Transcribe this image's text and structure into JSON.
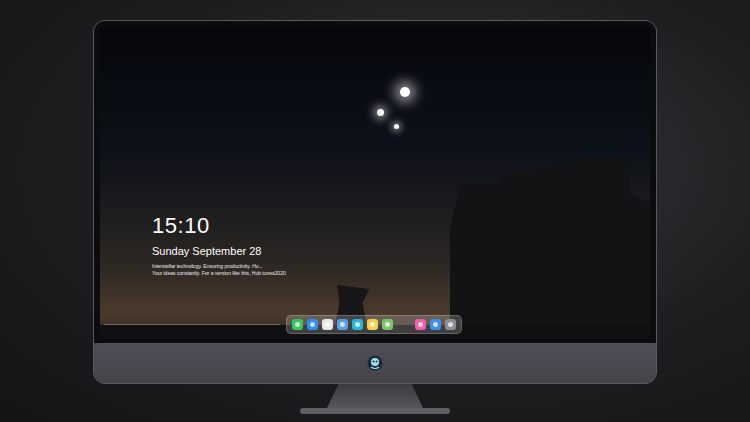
{
  "clock": {
    "time": "15:10",
    "date": "Sunday September 28",
    "notes": [
      "Interstellar technology. Ensuring productivity. Hu...",
      "Your ideas constantly. For a version like this, Hub tunes2020"
    ]
  },
  "dock": {
    "items": [
      {
        "color": "#34c759"
      },
      {
        "color": "#2f8ff0"
      },
      {
        "color": "#e8e8ea"
      },
      {
        "color": "#5aa0e0"
      },
      {
        "color": "#29b6d8"
      },
      {
        "color": "#f7d046"
      },
      {
        "color": "#7cc36a"
      },
      {
        "color": "#f35ea8"
      },
      {
        "color": "#3d8fe8"
      },
      {
        "color": "#8e8e93"
      }
    ]
  }
}
